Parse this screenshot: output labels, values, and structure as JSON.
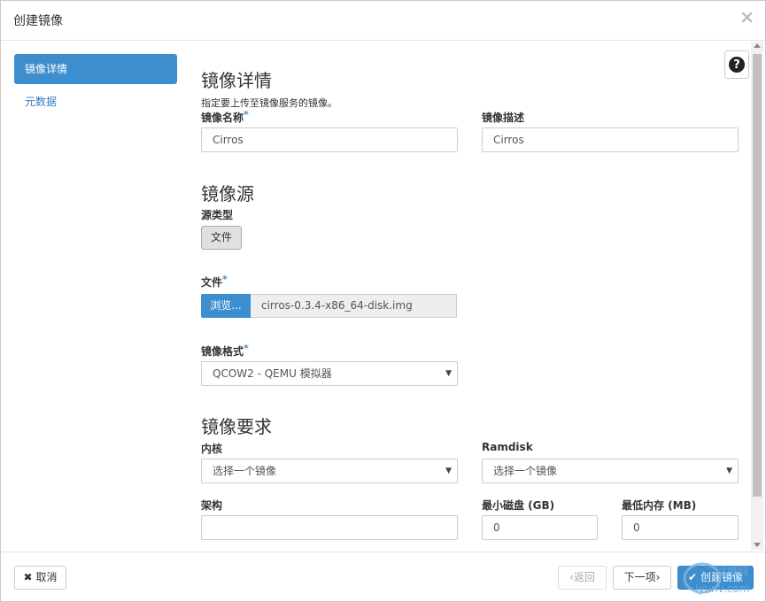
{
  "dialog": {
    "title": "创建镜像",
    "close_glyph": "×"
  },
  "nav": {
    "items": [
      {
        "label": "镜像详情",
        "active": true
      },
      {
        "label": "元数据",
        "active": false
      }
    ]
  },
  "help": {
    "glyph": "?"
  },
  "details": {
    "heading": "镜像详情",
    "help_text": "指定要上传至镜像服务的镜像。",
    "name_label": "镜像名称",
    "name_value": "Cirros",
    "desc_label": "镜像描述",
    "desc_value": "Cirros"
  },
  "source": {
    "heading": "镜像源",
    "type_label": "源类型",
    "type_button": "文件",
    "file_label": "文件",
    "browse_label": "浏览...",
    "file_name": "cirros-0.3.4-x86_64-disk.img",
    "format_label": "镜像格式",
    "format_value": "QCOW2 - QEMU 模拟器"
  },
  "requirements": {
    "heading": "镜像要求",
    "kernel_label": "内核",
    "kernel_value": "选择一个镜像",
    "ramdisk_label": "Ramdisk",
    "ramdisk_value": "选择一个镜像",
    "arch_label": "架构",
    "arch_value": "",
    "min_disk_label": "最小磁盘 (GB)",
    "min_disk_value": "0",
    "min_ram_label": "最低内存 (MB)",
    "min_ram_value": "0"
  },
  "footer": {
    "cancel_label": "取消",
    "cancel_icon": "close-icon",
    "back_label": "‹返回",
    "next_label": "下一项›",
    "create_label": "创建镜像",
    "create_icon": "check-icon"
  },
  "required_marker": "*",
  "colors": {
    "accent": "#3d8ecf"
  },
  "watermark": {
    "text_top": "运维网",
    "text_bottom": "iyunv.com"
  }
}
